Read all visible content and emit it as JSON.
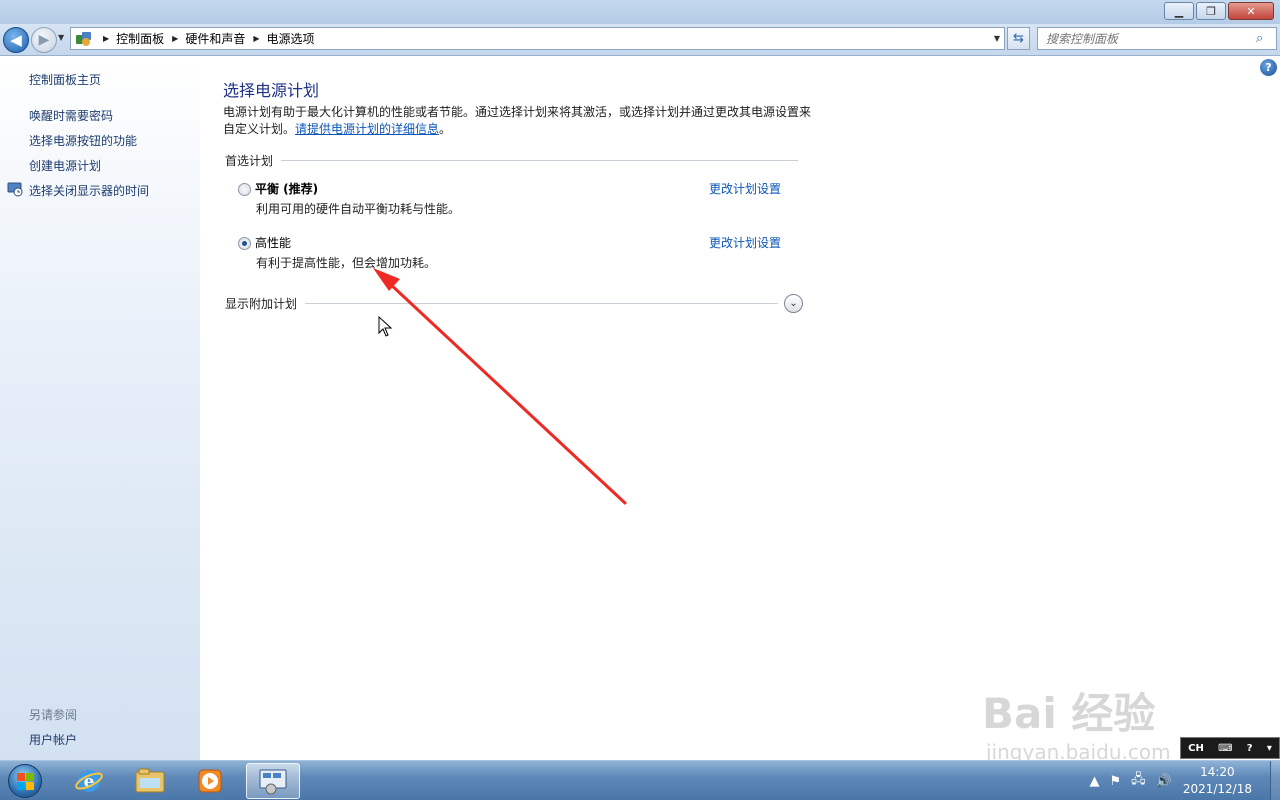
{
  "breadcrumb": [
    "控制面板",
    "硬件和声音",
    "电源选项"
  ],
  "search": {
    "placeholder": "搜索控制面板"
  },
  "left_pane": {
    "home": "控制面板主页",
    "links": [
      "唤醒时需要密码",
      "选择电源按钮的功能",
      "创建电源计划",
      "选择关闭显示器的时间"
    ],
    "see_also_title": "另请参阅",
    "see_also_links": [
      "用户帐户"
    ]
  },
  "main": {
    "title": "选择电源计划",
    "desc_text": "电源计划有助于最大化计算机的性能或者节能。通过选择计划来将其激活，或选择计划并通过更改其电源设置来自定义计划。",
    "desc_link": "请提供电源计划的详细信息",
    "desc_end": "。",
    "group_title": "首选计划",
    "plans": [
      {
        "name": "平衡 (推荐)",
        "desc": "利用可用的硬件自动平衡功耗与性能。",
        "link": "更改计划设置",
        "selected": false
      },
      {
        "name": "高性能",
        "desc": "有利于提高性能，但会增加功耗。",
        "link": "更改计划设置",
        "selected": true
      }
    ],
    "expander": "显示附加计划"
  },
  "taskbar": {
    "time": "14:20",
    "date": "2021/12/18",
    "lang": "CH"
  },
  "watermark": {
    "main": "Bai 经验",
    "sub": "jingyan.baidu.com"
  },
  "colors": {
    "link": "#0b56b8",
    "title": "#1e3287",
    "annotation_arrow": "#ee2a24"
  },
  "icons": [
    "back-icon",
    "forward-icon",
    "control-panel-icon",
    "refresh-icon",
    "search-icon",
    "help-icon",
    "display-timer-icon",
    "chevron-down-icon",
    "start-orb-icon",
    "ie-icon",
    "explorer-icon",
    "media-player-icon",
    "power-options-icon",
    "flag-icon",
    "network-icon",
    "volume-icon"
  ]
}
